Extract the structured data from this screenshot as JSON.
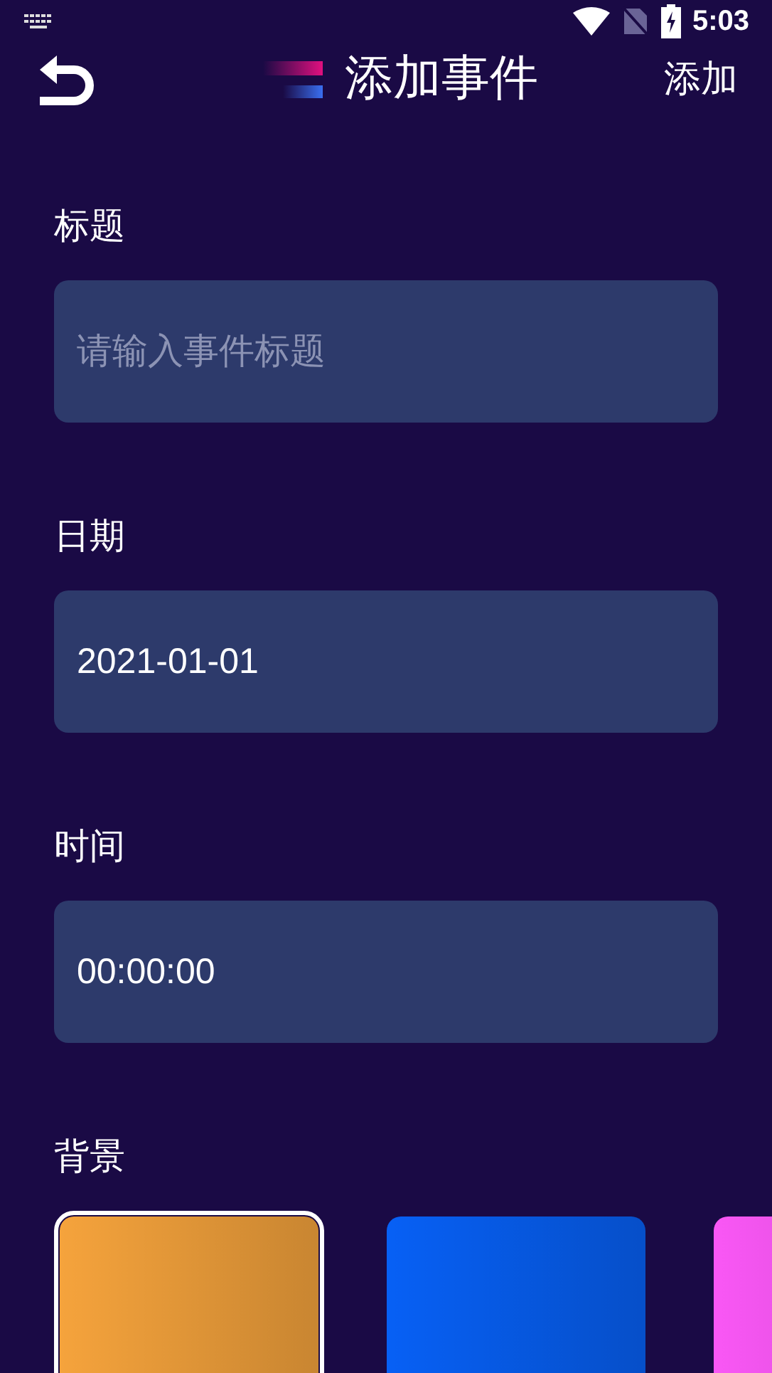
{
  "status_bar": {
    "time": "5:03"
  },
  "header": {
    "title": "添加事件",
    "action": "添加"
  },
  "fields": [
    {
      "label": "标题",
      "placeholder": "请输入事件标题"
    },
    {
      "label": "日期",
      "value": "2021-01-01"
    },
    {
      "label": "时间",
      "value": "00:00:00"
    }
  ],
  "background": {
    "label": "背景",
    "swatches": [
      {
        "color": "#f5a33c",
        "selected": true
      },
      {
        "color": "#0760f5",
        "selected": false
      },
      {
        "color": "#f957f5",
        "selected": false
      }
    ]
  }
}
